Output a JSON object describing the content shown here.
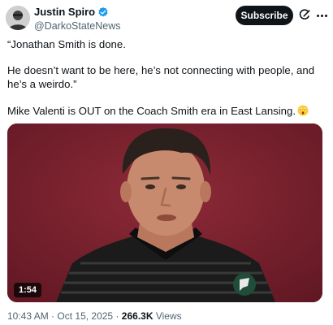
{
  "author": {
    "display_name": "Justin Spiro",
    "handle": "@DarkoStateNews",
    "verified": true
  },
  "actions": {
    "subscribe_label": "Subscribe"
  },
  "tweet": {
    "paragraph1": "“Jonathan Smith is done.",
    "paragraph2": "He doesn’t want to be here, he’s not connecting with people, and he’s a weirdo.”",
    "paragraph3": "Mike Valenti is OUT on the Coach Smith era in East Lansing."
  },
  "media": {
    "duration": "1:54"
  },
  "meta": {
    "time": "10:43 AM",
    "separator": "·",
    "date": "Oct 15, 2025",
    "views_count": "266.3K",
    "views_label": "Views"
  },
  "colors": {
    "text": "#0f1419",
    "secondary_text": "#536471",
    "verified_blue": "#1d9bf0",
    "subscribe_bg": "#0f1419"
  }
}
